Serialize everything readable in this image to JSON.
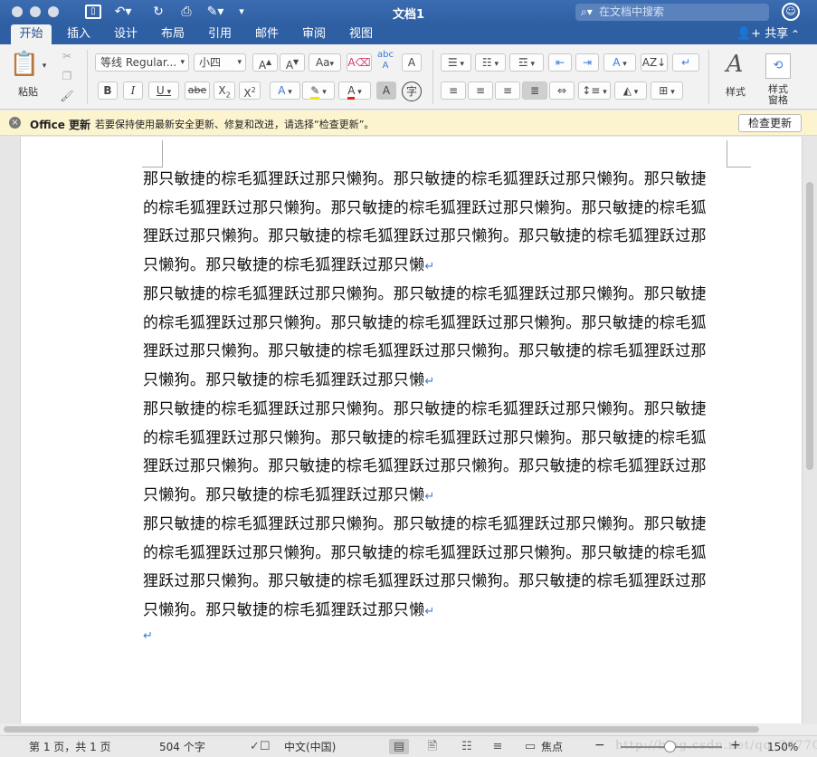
{
  "window": {
    "title": "文档1"
  },
  "search": {
    "placeholder": "在文档中搜索"
  },
  "tabs": [
    {
      "label": "开始",
      "active": true
    },
    {
      "label": "插入"
    },
    {
      "label": "设计"
    },
    {
      "label": "布局"
    },
    {
      "label": "引用"
    },
    {
      "label": "邮件"
    },
    {
      "label": "审阅"
    },
    {
      "label": "视图"
    }
  ],
  "share": {
    "label": "共享"
  },
  "ribbon": {
    "paste_label": "粘贴",
    "font_name": "等线 Regular...",
    "font_size": "小四",
    "grow_font": "A",
    "shrink_font": "A",
    "change_case": "Aa",
    "clear_format": "A",
    "phonetic": "abc",
    "char_border": "A",
    "bold": "B",
    "italic": "I",
    "underline": "U",
    "strikethrough": "abe",
    "subscript": "X",
    "superscript": "X",
    "text_effects": "A",
    "highlight": "ab",
    "font_color": "A",
    "char_shading": "A",
    "enclose_char": "字",
    "styles_label": "样式",
    "styles_pane_label_1": "样式",
    "styles_pane_label_2": "窗格"
  },
  "message_bar": {
    "title": "Office 更新",
    "text": "若要保持使用最新安全更新、修复和改进，请选择“检查更新”。",
    "button": "检查更新"
  },
  "document": {
    "paragraphs": [
      "那只敏捷的棕毛狐狸跃过那只懒狗。那只敏捷的棕毛狐狸跃过那只懒狗。那只敏捷的棕毛狐狸跃过那只懒狗。那只敏捷的棕毛狐狸跃过那只懒狗。那只敏捷的棕毛狐狸跃过那只懒狗。那只敏捷的棕毛狐狸跃过那只懒狗。那只敏捷的棕毛狐狸跃过那只懒狗。那只敏捷的棕毛狐狸跃过那只懒",
      "那只敏捷的棕毛狐狸跃过那只懒狗。那只敏捷的棕毛狐狸跃过那只懒狗。那只敏捷的棕毛狐狸跃过那只懒狗。那只敏捷的棕毛狐狸跃过那只懒狗。那只敏捷的棕毛狐狸跃过那只懒狗。那只敏捷的棕毛狐狸跃过那只懒狗。那只敏捷的棕毛狐狸跃过那只懒狗。那只敏捷的棕毛狐狸跃过那只懒",
      "那只敏捷的棕毛狐狸跃过那只懒狗。那只敏捷的棕毛狐狸跃过那只懒狗。那只敏捷的棕毛狐狸跃过那只懒狗。那只敏捷的棕毛狐狸跃过那只懒狗。那只敏捷的棕毛狐狸跃过那只懒狗。那只敏捷的棕毛狐狸跃过那只懒狗。那只敏捷的棕毛狐狸跃过那只懒狗。那只敏捷的棕毛狐狸跃过那只懒",
      "那只敏捷的棕毛狐狸跃过那只懒狗。那只敏捷的棕毛狐狸跃过那只懒狗。那只敏捷的棕毛狐狸跃过那只懒狗。那只敏捷的棕毛狐狸跃过那只懒狗。那只敏捷的棕毛狐狸跃过那只懒狗。那只敏捷的棕毛狐狸跃过那只懒狗。那只敏捷的棕毛狐狸跃过那只懒狗。那只敏捷的棕毛狐狸跃过那只懒"
    ],
    "paragraph_mark": "↵"
  },
  "status": {
    "page": "第 1 页，共 1 页",
    "word_count": "504 个字",
    "language": "中文(中国)",
    "focus": "焦点",
    "zoom": "150%",
    "watermark": "http://blog.csdn.net/qq_36770641"
  },
  "colors": {
    "title_bar": "#2f5fa3",
    "ribbon_bg": "#f2f2f2",
    "message_bar": "#fcf3cf",
    "paragraph_mark": "#3b7bd6"
  }
}
